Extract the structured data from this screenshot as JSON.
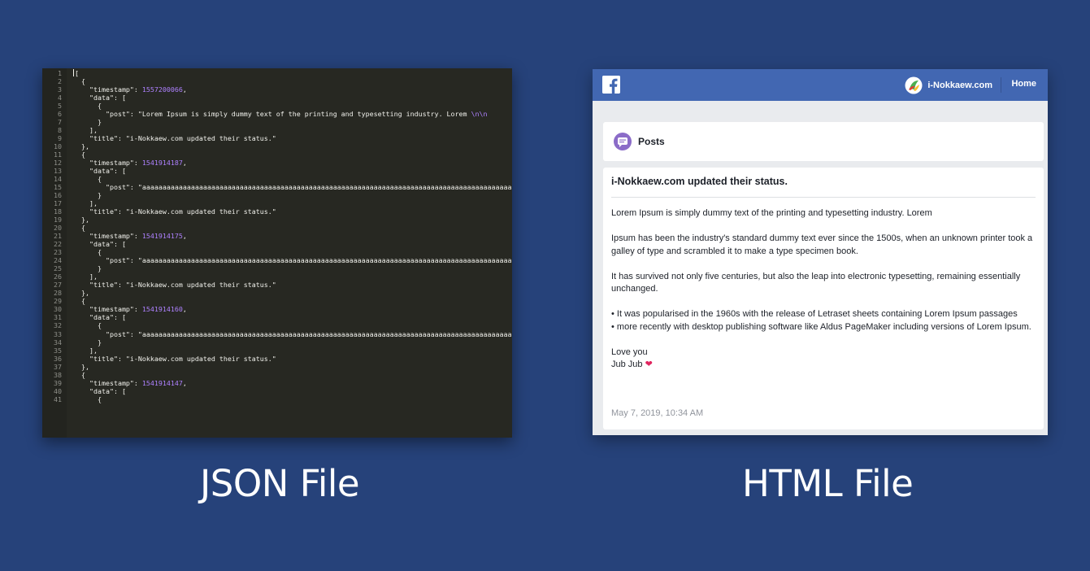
{
  "editor": {
    "lines": [
      [
        {
          "t": "["
        }
      ],
      [
        {
          "t": "  {"
        }
      ],
      [
        {
          "t": "    \"timestamp\": "
        },
        {
          "t": "1557200066",
          "c": "num"
        },
        {
          "t": ","
        }
      ],
      [
        {
          "t": "    \"data\": ["
        }
      ],
      [
        {
          "t": "      {"
        }
      ],
      [
        {
          "t": "        \"post\": \"Lorem Ipsum is simply dummy text of the printing and typesetting industry. Lorem "
        },
        {
          "t": "\\n\\n",
          "c": "esc"
        }
      ],
      [
        {
          "t": "      }"
        }
      ],
      [
        {
          "t": "    ],"
        }
      ],
      [
        {
          "t": "    \"title\": \"i-Nokkaew.com updated their status.\""
        }
      ],
      [
        {
          "t": "  },"
        }
      ],
      [
        {
          "t": "  {"
        }
      ],
      [
        {
          "t": "    \"timestamp\": "
        },
        {
          "t": "1541914187",
          "c": "num"
        },
        {
          "t": ","
        }
      ],
      [
        {
          "t": "    \"data\": ["
        }
      ],
      [
        {
          "t": "      {"
        }
      ],
      [
        {
          "t": "        \"post\": \"aaaaaaaaaaaaaaaaaaaaaaaaaaaaaaaaaaaaaaaaaaaaaaaaaaaaaaaaaaaaaaaaaaaaaaaaaaaaaaaaaaaaaaaaaaaaa"
        }
      ],
      [
        {
          "t": "      }"
        }
      ],
      [
        {
          "t": "    ],"
        }
      ],
      [
        {
          "t": "    \"title\": \"i-Nokkaew.com updated their status.\""
        }
      ],
      [
        {
          "t": "  },"
        }
      ],
      [
        {
          "t": "  {"
        }
      ],
      [
        {
          "t": "    \"timestamp\": "
        },
        {
          "t": "1541914175",
          "c": "num"
        },
        {
          "t": ","
        }
      ],
      [
        {
          "t": "    \"data\": ["
        }
      ],
      [
        {
          "t": "      {"
        }
      ],
      [
        {
          "t": "        \"post\": \"aaaaaaaaaaaaaaaaaaaaaaaaaaaaaaaaaaaaaaaaaaaaaaaaaaaaaaaaaaaaaaaaaaaaaaaaaaaaaaaaaaaaaaaaaaaaa"
        }
      ],
      [
        {
          "t": "      }"
        }
      ],
      [
        {
          "t": "    ],"
        }
      ],
      [
        {
          "t": "    \"title\": \"i-Nokkaew.com updated their status.\""
        }
      ],
      [
        {
          "t": "  },"
        }
      ],
      [
        {
          "t": "  {"
        }
      ],
      [
        {
          "t": "    \"timestamp\": "
        },
        {
          "t": "1541914160",
          "c": "num"
        },
        {
          "t": ","
        }
      ],
      [
        {
          "t": "    \"data\": ["
        }
      ],
      [
        {
          "t": "      {"
        }
      ],
      [
        {
          "t": "        \"post\": \"aaaaaaaaaaaaaaaaaaaaaaaaaaaaaaaaaaaaaaaaaaaaaaaaaaaaaaaaaaaaaaaaaaaaaaaaaaaaaaaaaaaaaaaaaaaaa"
        }
      ],
      [
        {
          "t": "      }"
        }
      ],
      [
        {
          "t": "    ],"
        }
      ],
      [
        {
          "t": "    \"title\": \"i-Nokkaew.com updated their status.\""
        }
      ],
      [
        {
          "t": "  },"
        }
      ],
      [
        {
          "t": "  {"
        }
      ],
      [
        {
          "t": "    \"timestamp\": "
        },
        {
          "t": "1541914147",
          "c": "num"
        },
        {
          "t": ","
        }
      ],
      [
        {
          "t": "    \"data\": ["
        }
      ],
      [
        {
          "t": "      {"
        }
      ]
    ]
  },
  "fb": {
    "brand_name": "i-Nokkaew.com",
    "home_label": "Home",
    "posts_label": "Posts",
    "post": {
      "title": "i-Nokkaew.com updated their status.",
      "paragraph_1": "Lorem Ipsum is simply dummy text of the printing and typesetting industry. Lorem",
      "paragraph_2": "Ipsum has been the industry's standard dummy text ever since the 1500s, when an unknown printer took a galley of type and scrambled it to make a type specimen book.",
      "paragraph_3": "It has survived not only five centuries, but also the leap into electronic typesetting, remaining essentially unchanged.",
      "bullet_1": "• It was popularised in the 1960s with the release of Letraset sheets containing Lorem Ipsum passages",
      "bullet_2": "• more recently with desktop publishing software like Aldus PageMaker including versions of Lorem Ipsum.",
      "signoff_1": "Love you",
      "signoff_2": "Jub Jub",
      "heart": "❤",
      "date": "May 7, 2019, 10:34 AM"
    }
  },
  "captions": {
    "json_label": "JSON File",
    "html_label": "HTML File"
  },
  "colors": {
    "background": "#26427a",
    "editor_bg": "#272822",
    "fb_blue": "#4267b2",
    "number_purple": "#ae81ff",
    "posts_icon_purple": "#8b6cc8"
  },
  "icons": {
    "fb_logo": "facebook-f-icon",
    "brand_logo": "i-nokkaew-logo",
    "posts": "posts-icon"
  }
}
